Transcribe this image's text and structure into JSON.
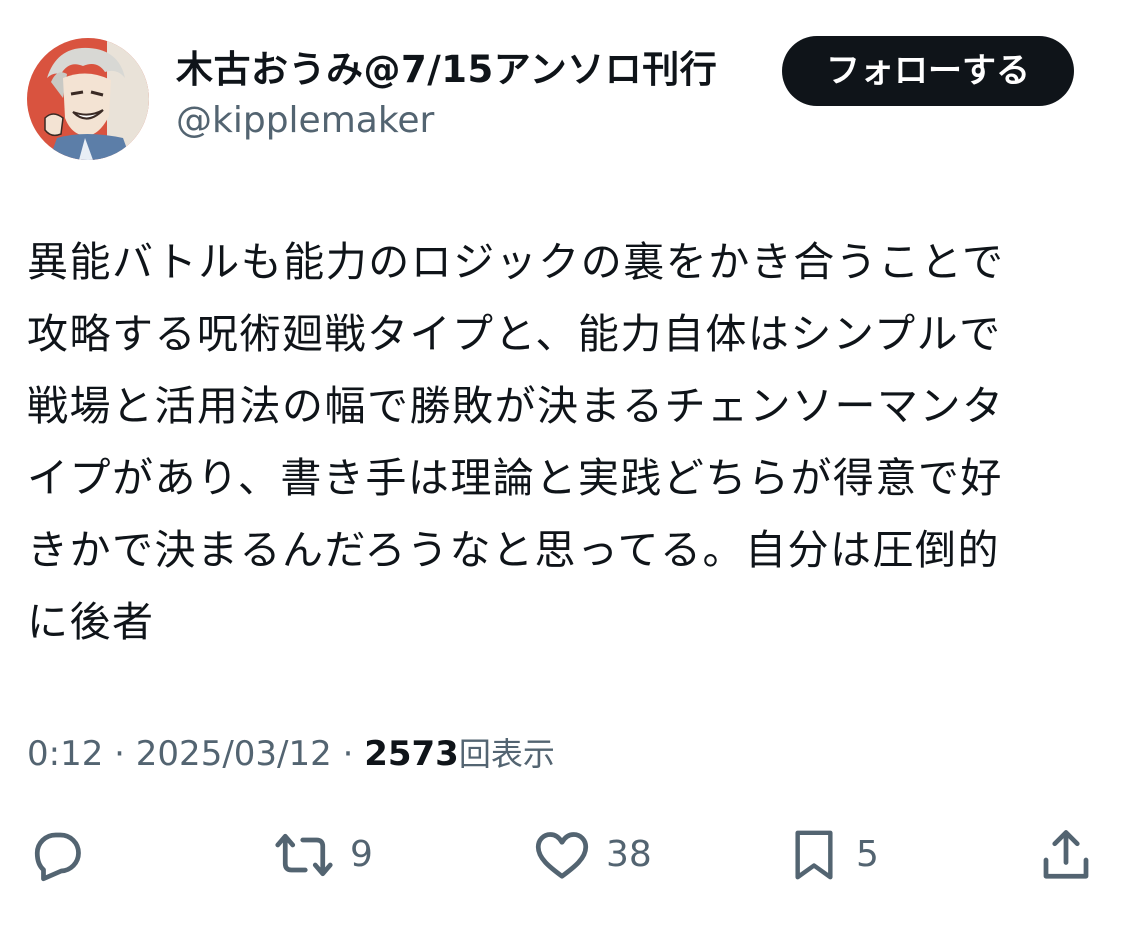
{
  "user": {
    "display_name": "木古おうみ@7/15アンソロ刊行",
    "handle": "@kipplemaker",
    "follow_label": "フォローする"
  },
  "tweet": {
    "lines": [
      "異能バトルも能力のロジックの裏をかき合うことで",
      "攻略する呪術廻戦タイプと、能力自体はシンプルで",
      "戦場と活用法の幅で勝敗が決まるチェンソーマンタ",
      "イプがあり、書き手は理論と実践どちらが得意で好",
      "きかで決まるんだろうなと思ってる。自分は圧倒的",
      "に後者"
    ]
  },
  "meta": {
    "time": "0:12",
    "separator": "·",
    "date": "2025/03/12",
    "views_count": "2573",
    "views_label": "回表示"
  },
  "actions": {
    "reply_icon": "reply-bubble-icon",
    "retweet_icon": "retweet-icon",
    "retweet_count": "9",
    "like_icon": "heart-icon",
    "like_count": "38",
    "bookmark_icon": "bookmark-icon",
    "bookmark_count": "5",
    "share_icon": "share-upload-icon"
  },
  "colors": {
    "text_primary": "#0f1419",
    "text_secondary": "#536471",
    "follow_bg": "#0f1419",
    "follow_text": "#ffffff",
    "avatar_accent": "#d9533f"
  }
}
